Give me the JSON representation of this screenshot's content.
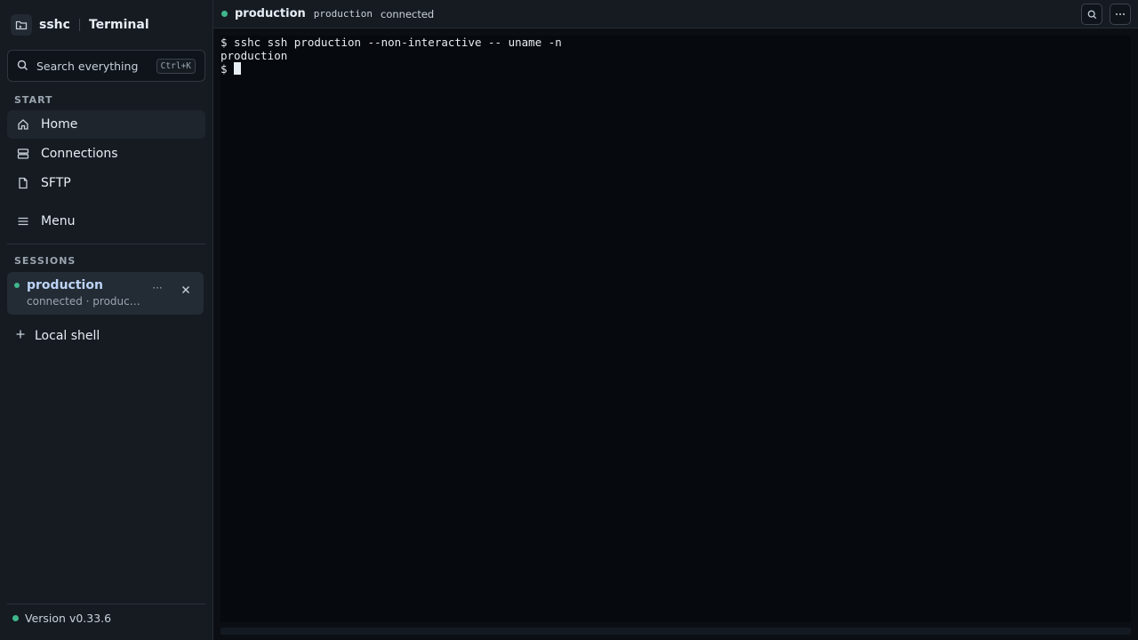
{
  "brand": {
    "name": "sshc",
    "section": "Terminal"
  },
  "search": {
    "placeholder": "Search everything",
    "shortcut": "Ctrl+K"
  },
  "sidebar": {
    "start_label": "START",
    "items": [
      {
        "label": "Home",
        "icon": "home-icon",
        "active": true
      },
      {
        "label": "Connections",
        "icon": "server-icon"
      },
      {
        "label": "SFTP",
        "icon": "file-icon"
      },
      {
        "label": "Menu",
        "icon": "menu-icon"
      }
    ],
    "sessions_label": "SESSIONS",
    "sessions": [
      {
        "name": "production",
        "subtitle": "connected · production",
        "status_color": "#3fb68b"
      }
    ],
    "local_shell_label": "Local shell",
    "version": "Version v0.33.6"
  },
  "topbar": {
    "title": "production",
    "host": "production",
    "status": "connected"
  },
  "terminal": {
    "lines": [
      "$ sshc ssh production --non-interactive -- uname -n",
      "production",
      "$ "
    ]
  },
  "colors": {
    "accent": "#3fb68b",
    "session_name": "#bcd3f5",
    "background": "#0d1117"
  }
}
